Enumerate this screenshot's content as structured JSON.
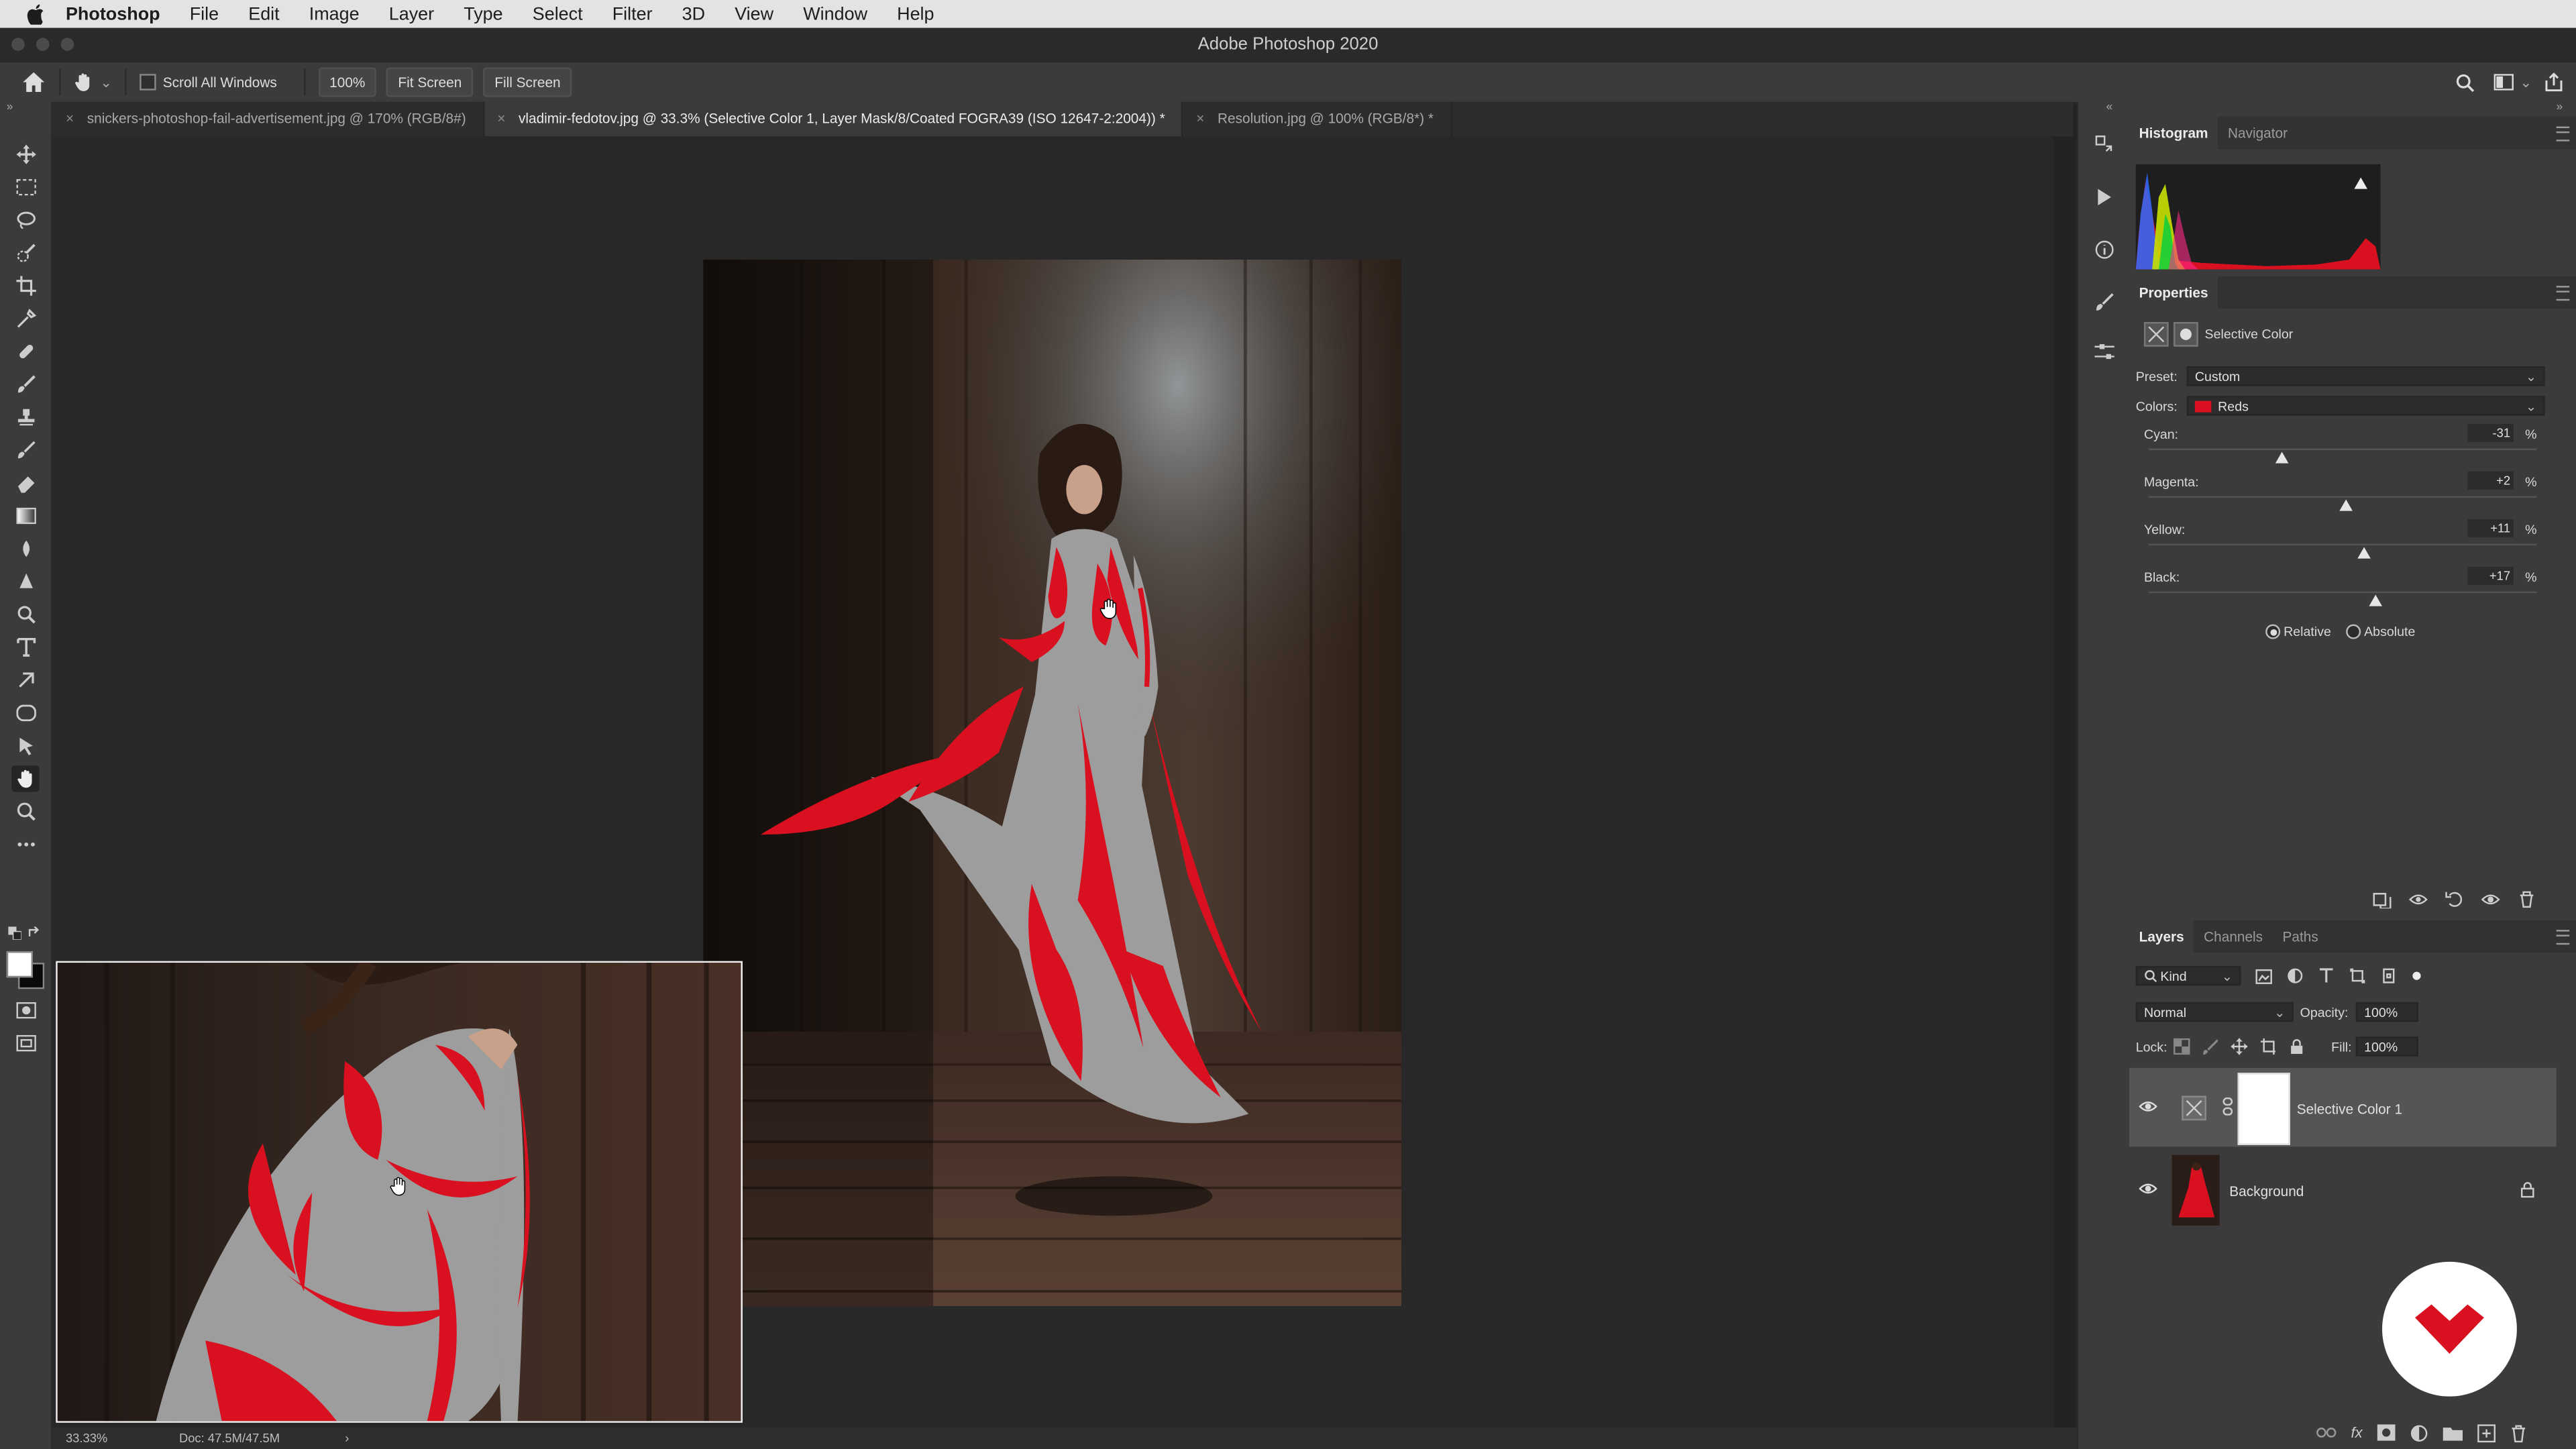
{
  "menubar": {
    "app_name": "Photoshop",
    "items": [
      "File",
      "Edit",
      "Image",
      "Layer",
      "Type",
      "Select",
      "Filter",
      "3D",
      "View",
      "Window",
      "Help"
    ]
  },
  "window": {
    "title": "Adobe Photoshop 2020"
  },
  "options_bar": {
    "scroll_all_windows": "Scroll All Windows",
    "zoom_100": "100%",
    "fit_screen": "Fit Screen",
    "fill_screen": "Fill Screen"
  },
  "tabs": [
    {
      "label": "snickers-photoshop-fail-advertisement.jpg @ 170% (RGB/8#)",
      "active": false
    },
    {
      "label": "vladimir-fedotov.jpg @ 33.3% (Selective Color 1, Layer Mask/8/Coated FOGRA39 (ISO 12647-2:2004)) *",
      "active": true
    },
    {
      "label": "Resolution.jpg @ 100% (RGB/8*) *",
      "active": false
    }
  ],
  "status": {
    "zoom": "33.33%",
    "doc": "Doc: 47.5M/47.5M",
    "arrow": "›"
  },
  "histogram_panel": {
    "tabs": [
      "Histogram",
      "Navigator"
    ]
  },
  "properties": {
    "tab": "Properties",
    "adjustment": "Selective Color",
    "preset_label": "Preset:",
    "preset_value": "Custom",
    "colors_label": "Colors:",
    "colors_value": "Reds",
    "sliders": [
      {
        "label": "Cyan:",
        "value": "-31",
        "percent": -31
      },
      {
        "label": "Magenta:",
        "value": "+2",
        "percent": 2
      },
      {
        "label": "Yellow:",
        "value": "+11",
        "percent": 11
      },
      {
        "label": "Black:",
        "value": "+17",
        "percent": 17
      }
    ],
    "pct": "%",
    "method_relative": "Relative",
    "method_absolute": "Absolute",
    "method_selected": "Relative"
  },
  "layers_panel": {
    "tabs": [
      "Layers",
      "Channels",
      "Paths"
    ],
    "filter_kind": "Kind",
    "blend_mode": "Normal",
    "opacity_label": "Opacity:",
    "opacity_value": "100%",
    "lock_label": "Lock:",
    "fill_label": "Fill:",
    "fill_value": "100%",
    "layers": [
      {
        "name": "Selective Color 1",
        "selected": true
      },
      {
        "name": "Background",
        "selected": false
      }
    ]
  },
  "colors": {
    "accent_red": "#d8101f",
    "panel_bg": "#3b3b3b",
    "canvas_bg": "#282828"
  }
}
